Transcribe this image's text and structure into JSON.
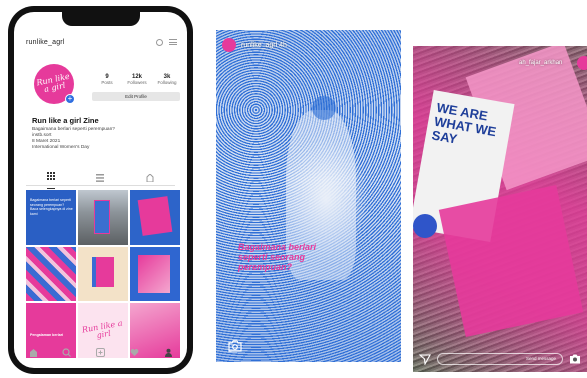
{
  "phone": {
    "username": "runlike_agrl",
    "avatar_text": "Run like a girl",
    "stats": [
      {
        "value": "9",
        "label": "Posts"
      },
      {
        "value": "12k",
        "label": "Followers"
      },
      {
        "value": "3k",
        "label": "Following"
      }
    ],
    "edit_profile": "Edit Profile",
    "bio": {
      "name": "Run like a girl Zine",
      "lines": [
        "Bagaimana berlari seperti perempuan?",
        "instb.sort",
        "8 Maret 2021",
        "International Women's Day"
      ]
    },
    "grid": {
      "cell1_text": "Bagaimana berlari seperti seorang perempuan? Baca selengkapnya di zine kami",
      "cell7_text": "Pengalaman berlari",
      "cell8_logo": "Run like a girl"
    }
  },
  "story1": {
    "username": "runlike_agrl 4h",
    "quote": "Bagaimana berlari seperti seorang perempuan?"
  },
  "story2": {
    "username": "ah_fajar_arkhan",
    "paper_text": "WE ARE WHAT WE SAY",
    "reply_placeholder": "Send message"
  },
  "colors": {
    "accent_pink": "#e63a9b",
    "accent_blue": "#2f6fd6"
  }
}
